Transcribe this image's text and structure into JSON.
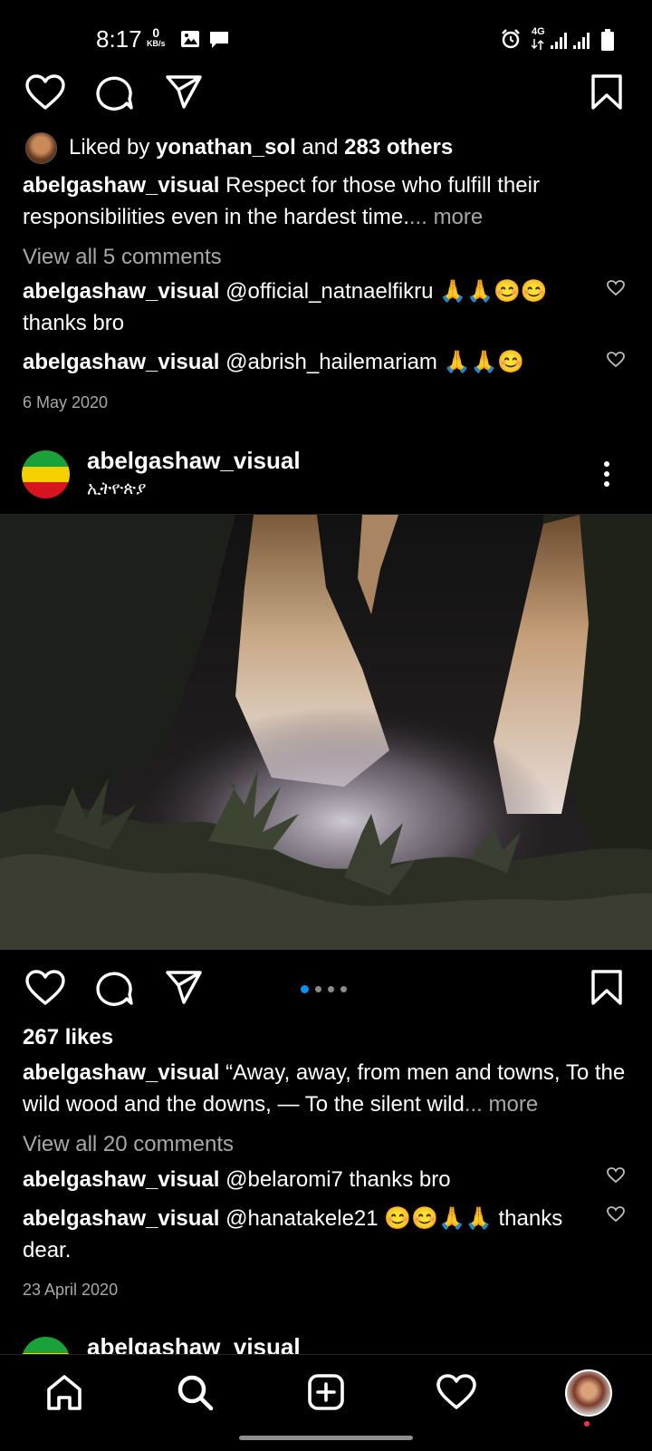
{
  "status_bar": {
    "time": "8:17",
    "net_speed": "0",
    "net_unit": "KB/s",
    "network": "4G"
  },
  "post1": {
    "liked_by_prefix": "Liked by ",
    "liked_by_user": "yonathan_sol",
    "liked_by_and": " and ",
    "liked_by_others": "283 others",
    "caption_user": "abelgashaw_visual",
    "caption_text": " Respect for those who fulfill their responsibilities even in the hardest time.",
    "caption_more": "... more",
    "view_comments": "View all 5 comments",
    "comments": [
      {
        "user": "abelgashaw_visual",
        "text": " @official_natnaelfikru 🙏🙏😊😊 thanks bro"
      },
      {
        "user": "abelgashaw_visual",
        "text": " @abrish_hailemariam 🙏🙏😊"
      }
    ],
    "date": "6 May 2020"
  },
  "post2": {
    "username": "abelgashaw_visual",
    "location": "ኢትዮጵያ",
    "likes": "267 likes",
    "caption_user": "abelgashaw_visual",
    "caption_text": " “Away, away, from men and towns,  To the wild wood and the downs, —  To the silent wild",
    "caption_more": "... more",
    "view_comments": "View all 20 comments",
    "comments": [
      {
        "user": "abelgashaw_visual",
        "text": " @belaromi7 thanks bro"
      },
      {
        "user": "abelgashaw_visual",
        "text": " @hanatakele21 😊😊🙏🙏 thanks dear."
      }
    ],
    "date": "23 April 2020",
    "carousel_count": 4,
    "carousel_index": 1
  },
  "post3": {
    "username": "abelgashaw_visual"
  },
  "colors": {
    "background": "#000000",
    "accent_blue": "#0095f6",
    "muted_text": "#a8a8a8",
    "notification_dot": "#ff3040"
  }
}
